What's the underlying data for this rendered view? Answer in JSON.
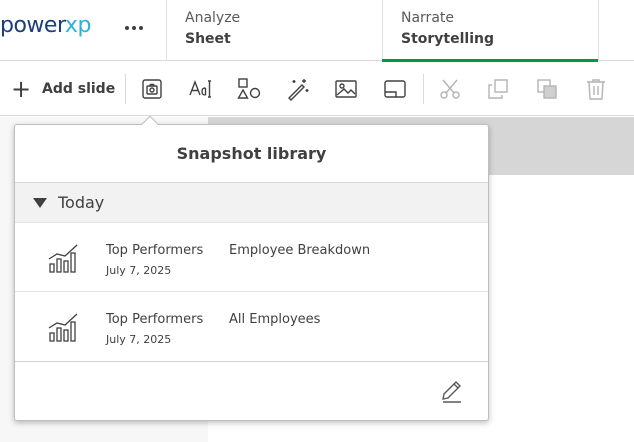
{
  "header": {
    "logo": {
      "part1": "power",
      "part2": "xp",
      "name": "powerxp-logo"
    },
    "tabs": [
      {
        "top": "Analyze",
        "bottom": "Sheet",
        "active": false
      },
      {
        "top": "Narrate",
        "bottom": "Storytelling",
        "active": true
      }
    ],
    "accent_color": "#009845"
  },
  "toolbar": {
    "add_slide_label": "Add slide",
    "tools": [
      {
        "icon": "snapshot-library-icon",
        "enabled": true,
        "selected": true
      },
      {
        "icon": "text-icon",
        "enabled": true
      },
      {
        "icon": "shapes-icon",
        "enabled": true
      },
      {
        "icon": "magic-wand-icon",
        "enabled": true
      },
      {
        "icon": "image-icon",
        "enabled": true
      },
      {
        "icon": "media-icon",
        "enabled": true
      },
      {
        "icon": "cut-icon",
        "enabled": false
      },
      {
        "icon": "copy-icon",
        "enabled": false
      },
      {
        "icon": "layers-icon",
        "enabled": false
      },
      {
        "icon": "delete-icon",
        "enabled": false
      }
    ]
  },
  "snapshot_library": {
    "title": "Snapshot library",
    "group_label": "Today",
    "items": [
      {
        "title": "Top Performers",
        "date": "July 7, 2025",
        "description": "Employee Breakdown"
      },
      {
        "title": "Top Performers",
        "date": "July 7, 2025",
        "description": "All Employees"
      }
    ]
  }
}
